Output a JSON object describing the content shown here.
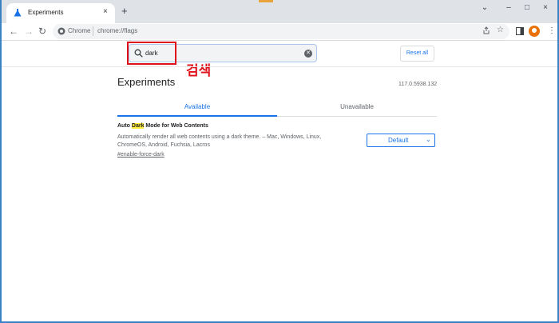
{
  "tab": {
    "title": "Experiments",
    "close": "×"
  },
  "new_tab": "+",
  "window_controls": {
    "collapse": "⌄",
    "minimize": "–",
    "maximize": "□",
    "close": "×"
  },
  "toolbar": {
    "back": "←",
    "forward": "→",
    "reload": "↻",
    "more": "⋮"
  },
  "omnibox": {
    "scheme_label": "Chrome",
    "url": "chrome://flags"
  },
  "search": {
    "value": "dark"
  },
  "callout": {
    "label": "검색",
    "color": "#e0101a"
  },
  "reset_all": "Reset all",
  "page": {
    "title": "Experiments",
    "version": "117.0.5938.132"
  },
  "tabs": {
    "available": "Available",
    "unavailable": "Unavailable"
  },
  "experiment": {
    "title_before": "Auto ",
    "title_highlight": "Dark",
    "title_after": " Mode for Web Contents",
    "description": "Automatically render all web contents using a dark theme. – Mac, Windows, Linux, ChromeOS, Android, Fuchsia, Lacros",
    "link": "#enable-force-dark",
    "select_value": "Default"
  },
  "colors": {
    "accent": "#1a73e8",
    "highlight": "#ffeb3b",
    "frame": "#3b82c4"
  }
}
